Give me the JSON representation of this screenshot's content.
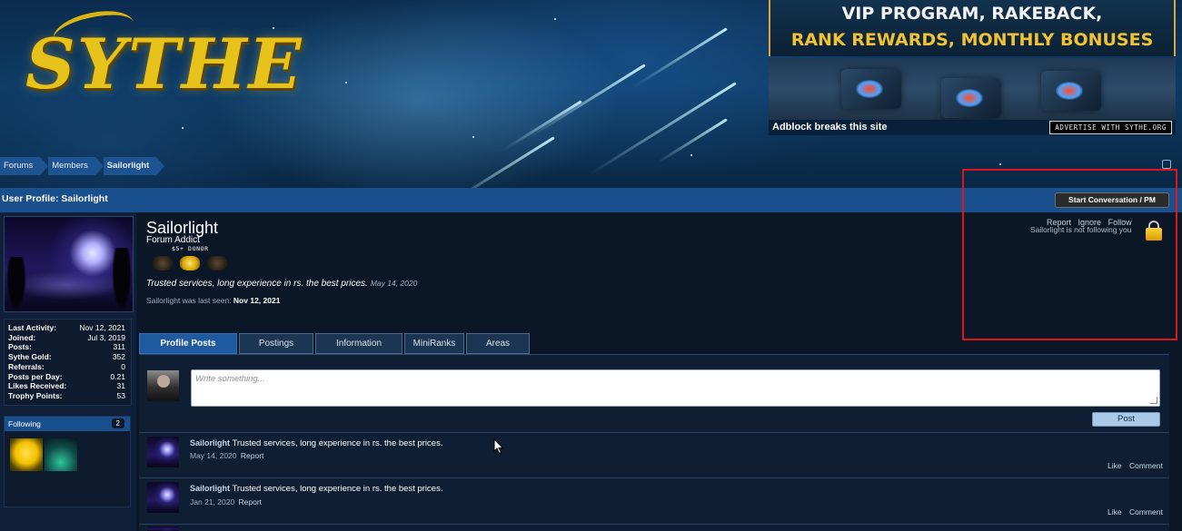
{
  "header": {
    "logo_text": "SYTHE",
    "ad_top_line1": "VIP PROGRAM, RAKEBACK,",
    "ad_top_line2": "RANK REWARDS, MONTHLY BONUSES",
    "adblock_notice": "Adblock breaks this site",
    "advertise_button": "ADVERTISE WITH SYTHE.ORG"
  },
  "breadcrumb": [
    "Forums",
    "Members",
    "Sailorlight"
  ],
  "title_bar": {
    "title": "User Profile: Sailorlight",
    "start_conversation": "Start Conversation / PM"
  },
  "sidebar": {
    "stats": [
      {
        "label": "Last Activity:",
        "value": "Nov 12, 2021"
      },
      {
        "label": "Joined:",
        "value": "Jul 3, 2019"
      },
      {
        "label": "Posts:",
        "value": "311"
      },
      {
        "label": "Sythe Gold:",
        "value": "352"
      },
      {
        "label": "Referrals:",
        "value": "0"
      },
      {
        "label": "Posts per Day:",
        "value": "0.21"
      },
      {
        "label": "Likes Received:",
        "value": "31"
      },
      {
        "label": "Trophy Points:",
        "value": "53"
      }
    ],
    "following_label": "Following",
    "following_count": "2"
  },
  "profile": {
    "username": "Sailorlight",
    "user_title": "Forum Addict",
    "donor_label": "$5+ DONOR",
    "status": "Trusted services, long experience in rs. the best prices.",
    "status_date": "May 14, 2020",
    "last_seen_prefix": "Sailorlight was last seen:",
    "last_seen_date": "Nov 12, 2021",
    "actions": [
      "Report",
      "Ignore",
      "Follow"
    ],
    "follow_status": "Sailorlight is not following you"
  },
  "tabs": [
    "Profile Posts",
    "Postings",
    "Information",
    "MiniRanks",
    "Areas"
  ],
  "compose": {
    "placeholder": "Write something...",
    "post_button": "Post"
  },
  "entries": [
    {
      "name": "Sailorlight",
      "text": "Trusted services, long experience in rs. the best prices.",
      "date": "May 14, 2020",
      "report": "Report",
      "like": "Like",
      "comment": "Comment"
    },
    {
      "name": "Sailorlight",
      "text": "Trusted services, long experience in rs. the best prices.",
      "date": "Jan 21, 2020",
      "report": "Report",
      "like": "Like",
      "comment": "Comment"
    }
  ],
  "colors": {
    "accent_blue": "#1a4f8d",
    "highlight_red": "#e0151b",
    "logo_gold": "#e6c21a"
  }
}
